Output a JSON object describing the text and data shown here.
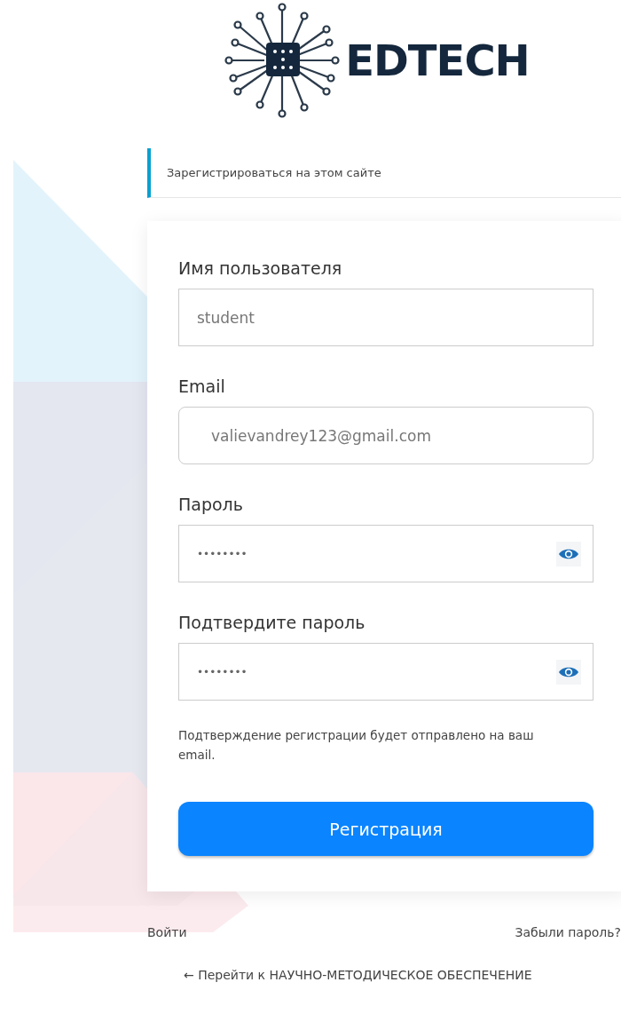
{
  "logo": {
    "text": "EDTECH"
  },
  "notice": "Зарегистрироваться на этом сайте",
  "fields": [
    {
      "kind": "text",
      "label": "Имя пользователя",
      "value": "student",
      "rounded": false
    },
    {
      "kind": "text",
      "label": "Email",
      "value": "valievandrey123@gmail.com",
      "rounded": true
    },
    {
      "kind": "password",
      "label": "Пароль",
      "value": "••••••••",
      "rounded": false
    },
    {
      "kind": "password",
      "label": "Подтвердите пароль",
      "value": "••••••••",
      "rounded": false
    }
  ],
  "hint": "Подтверждение регистрации будет отправлено на ваш email.",
  "submit": "Регистрация",
  "links": {
    "login": "Войти",
    "forgot": "Забыли пароль?"
  },
  "back_link": "← Перейти к НАУЧНО-МЕТОДИЧЕСКОЕ ОБЕСПЕЧЕНИЕ"
}
